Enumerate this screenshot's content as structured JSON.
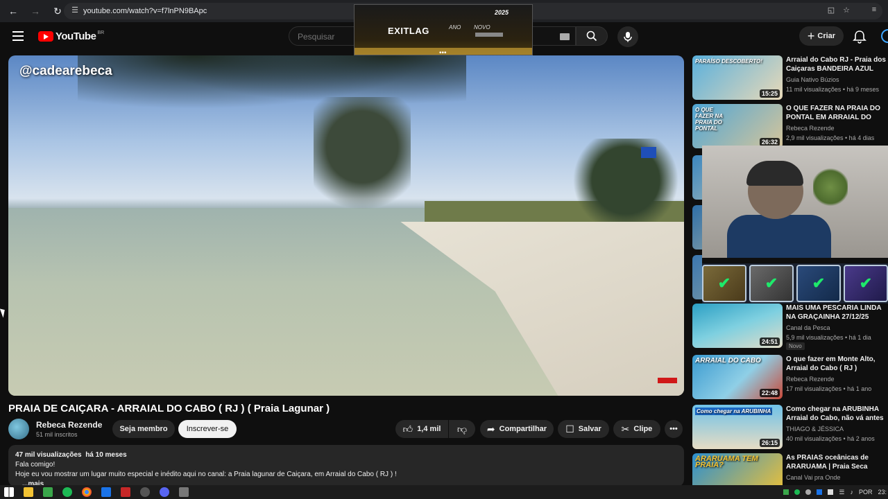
{
  "browser": {
    "url": "youtube.com/watch?v=f7lnPN9BApc"
  },
  "header": {
    "logo_text": "YouTube",
    "country_code": "BR",
    "search_placeholder": "Pesquisar",
    "create_label": "Criar"
  },
  "overlay_ad": {
    "brand": "EXITLAG",
    "tag1": "ANO",
    "tag2": "NOVO",
    "year": "2025"
  },
  "video": {
    "watermark": "@cadearebeca",
    "title": "PRAIA DE CAIÇARA - ARRAIAL DO CABO ( RJ ) ( Praia Lagunar )",
    "channel": "Rebeca Rezende",
    "subscribers": "51 mil inscritos",
    "join_label": "Seja membro",
    "subscribe_label": "Inscrever-se",
    "likes": "1,4 mil",
    "share_label": "Compartilhar",
    "save_label": "Salvar",
    "clip_label": "Clipe",
    "views": "47 mil visualizações",
    "date": "há 10 meses",
    "desc_line1": "Fala comigo!",
    "desc_line2": "Hoje eu vou mostrar um lugar muito especial e inédito aqui no canal: a Praia lagunar de Caiçara, em Arraial do Cabo ( RJ ) !",
    "more": "...mais"
  },
  "recommendations": [
    {
      "title": "Arraial do Cabo RJ - Praia dos Caiçaras BANDEIRA AZUL",
      "channel": "Guia Nativo Búzios",
      "meta": "11 mil visualizações • há 9 meses",
      "duration": "15:25",
      "overlay": "PARAÍSO DESCOBERTO!",
      "color1": "#5ab0dc",
      "color2": "#e8d9b8"
    },
    {
      "title": "O QUE FAZER NA PRAIA DO PONTAL EM ARRAIAL DO CABO",
      "channel": "Rebeca Rezende",
      "meta": "2,9 mil visualizações • há 4 dias",
      "duration": "26:32",
      "overlay": "O QUE FAZER NA PRAIA DO PONTAL",
      "color1": "#4fa6d6",
      "color2": "#d6c59a"
    },
    {
      "title": "MAIS UMA PESCARIA LINDA NA GRAÇAINHA 27/12/25",
      "channel": "Canal da Pesca",
      "meta": "5,9 mil visualizações • há 1 dia",
      "duration": "24:51",
      "overlay": "",
      "badge": "Novo",
      "color1": "#2b9fc4",
      "color2": "#e2dcc8"
    },
    {
      "title": "O que fazer em Monte Alto, Arraial do Cabo ( RJ )",
      "channel": "Rebeca Rezende",
      "meta": "17 mil visualizações • há 1 ano",
      "duration": "22:48",
      "overlay": "ARRAIAL DO CABO",
      "color1": "#3a9ad0",
      "color2": "#c84a3a"
    },
    {
      "title": "Como chegar na ARUBINHA Arraial do Cabo, não vá antes ..",
      "channel": "THIAGO & JÉSSICA",
      "meta": "40 mil visualizações • há 2 anos",
      "duration": "26:15",
      "overlay": "Como chegar na ARUBINHA",
      "color1": "#6fc2e8",
      "color2": "#e6dcc4"
    },
    {
      "title": "As PRAIAS oceânicas de ARARUAMA | Praia Seca",
      "channel": "Canal Vai pra Onde",
      "meta": "",
      "duration": "",
      "overlay": "ARARUAMA TEM PRAIA?",
      "color1": "#2b8fd0",
      "color2": "#f2c233"
    }
  ],
  "taskbar": {
    "lang": "POR",
    "time": "23:"
  }
}
